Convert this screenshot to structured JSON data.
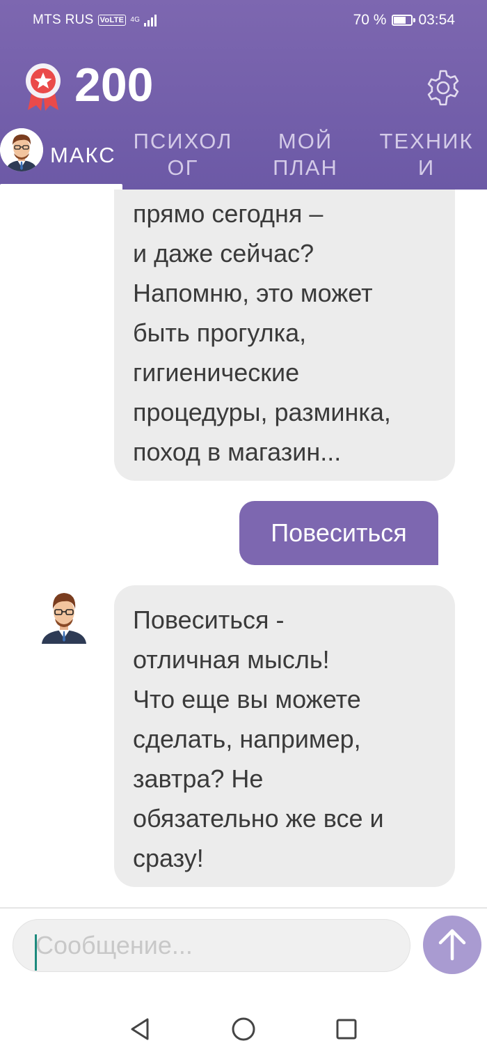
{
  "status_bar": {
    "carrier": "MTS RUS",
    "volte": "VoLTE",
    "network": "4G",
    "battery_percent": "70 %",
    "battery_level": 0.7,
    "time": "03:54"
  },
  "header": {
    "score": "200",
    "badge_icon": "award-ribbon-icon",
    "settings_icon": "gear-icon"
  },
  "tabs": [
    {
      "label": "МАКС",
      "active": true
    },
    {
      "label_line1": "ПСИХОЛ",
      "label_line2": "ОГ"
    },
    {
      "label_line1": "МОЙ",
      "label_line2": "ПЛАН"
    },
    {
      "label_line1": "ТЕХНИК",
      "label_line2": "И"
    }
  ],
  "messages": [
    {
      "from": "bot",
      "lines": [
        "прямо сегодня –",
        "и даже сейчас?",
        "Напомню, это может",
        "быть прогулка,",
        "гигиенические",
        "процедуры, разминка,",
        "поход в магазин..."
      ]
    },
    {
      "from": "user",
      "text": "Повеситься"
    },
    {
      "from": "bot",
      "lines": [
        "Повеситься -",
        "отличная мысль!",
        "Что еще вы можете",
        "сделать, например,",
        "завтра? Не",
        "обязательно же все и",
        "сразу!"
      ]
    }
  ],
  "composer": {
    "placeholder": "Сообщение...",
    "send_icon": "arrow-up-icon"
  },
  "colors": {
    "header": "#7262aa",
    "user_bubble": "#7d67b0",
    "bot_bubble": "#ececec",
    "send_button": "#a99bd1",
    "badge_red": "#ea4a4a"
  }
}
